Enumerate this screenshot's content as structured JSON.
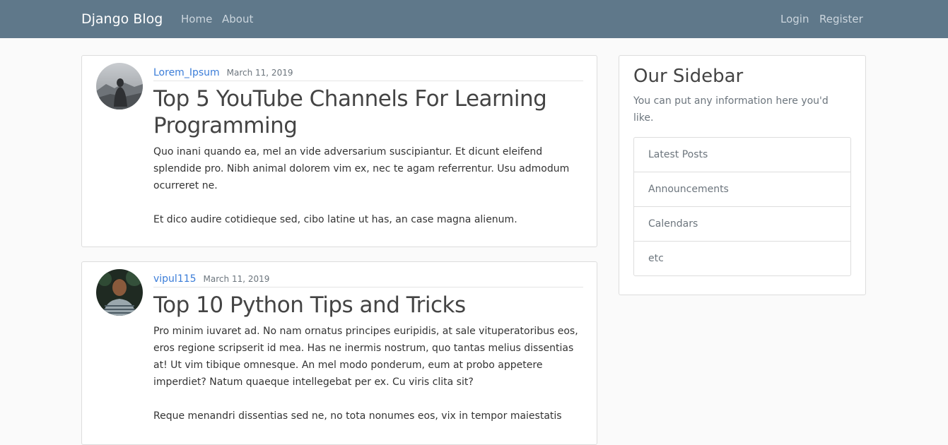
{
  "navbar": {
    "brand": "Django Blog",
    "links_left": [
      "Home",
      "About"
    ],
    "links_right": [
      "Login",
      "Register"
    ],
    "background_color": "#5f788a"
  },
  "posts": [
    {
      "author": "Lorem_Ipsum",
      "date": "March 11, 2019",
      "title": "Top 5 YouTube Channels For Learning Programming",
      "content": "Quo inani quando ea, mel an vide adversarium suscipiantur. Et dicunt eleifend splendide pro. Nibh animal dolorem vim ex, nec te agam referrentur. Usu admodum ocurreret ne.\n\nEt dico audire cotidieque sed, cibo latine ut has, an case magna alienum."
    },
    {
      "author": "vipul115",
      "date": "March 11, 2019",
      "title": "Top 10 Python Tips and Tricks",
      "content": "Pro minim iuvaret ad. No nam ornatus principes euripidis, at sale vituperatoribus eos, eros regione scripserit id mea. Has ne inermis nostrum, quo tantas melius dissentias at! Ut vim tibique omnesque. An mel modo ponderum, eum at probo appetere imperdiet? Natum quaeque intellegebat per ex. Cu viris clita sit?\n\nReque menandri dissentias sed ne, no tota nonumes eos, vix in tempor maiestatis"
    }
  ],
  "sidebar": {
    "title": "Our Sidebar",
    "description": "You can put any information here you'd like.",
    "items": [
      "Latest Posts",
      "Announcements",
      "Calendars",
      "etc"
    ]
  },
  "colors": {
    "link": "#3b7dd8",
    "muted": "#6c757d"
  }
}
